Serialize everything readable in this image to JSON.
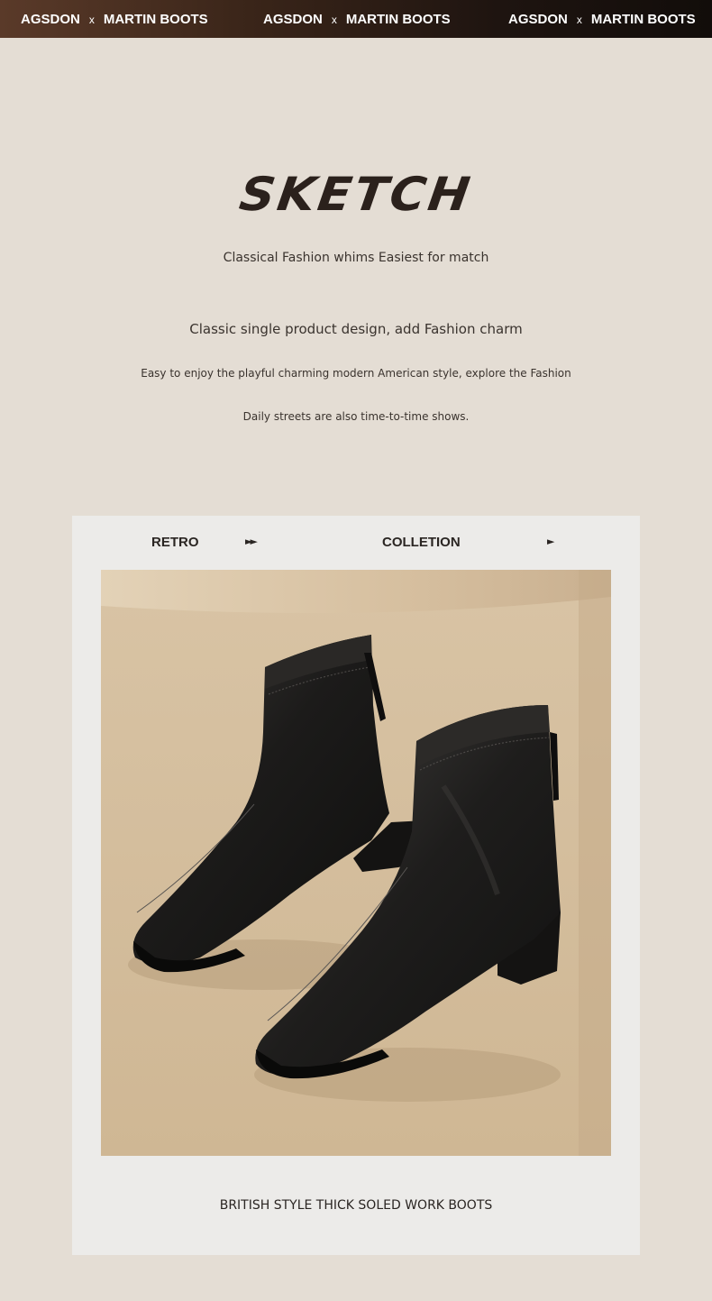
{
  "banner": {
    "brand": "AGSDON",
    "separator": "x",
    "product": "MARTIN BOOTS"
  },
  "heading": {
    "title": "SKETCH",
    "tagline": "Classical Fashion whims Easiest for match",
    "subtitle": "Classic single product design, add Fashion charm",
    "line1": "Easy to enjoy the playful charming modern American style, explore the Fashion",
    "line2": "Daily streets are also time-to-time shows."
  },
  "card": {
    "label_left": "RETRO",
    "arrow_left": "►►",
    "label_right": "COLLETION",
    "arrow_right": "►",
    "caption": "BRITISH STYLE THICK SOLED WORK BOOTS"
  },
  "colors": {
    "background": "#e4ddd4",
    "card": "#ecebe9",
    "photo_backdrop": "#d8c2a2",
    "boot": "#1c1b1a"
  }
}
